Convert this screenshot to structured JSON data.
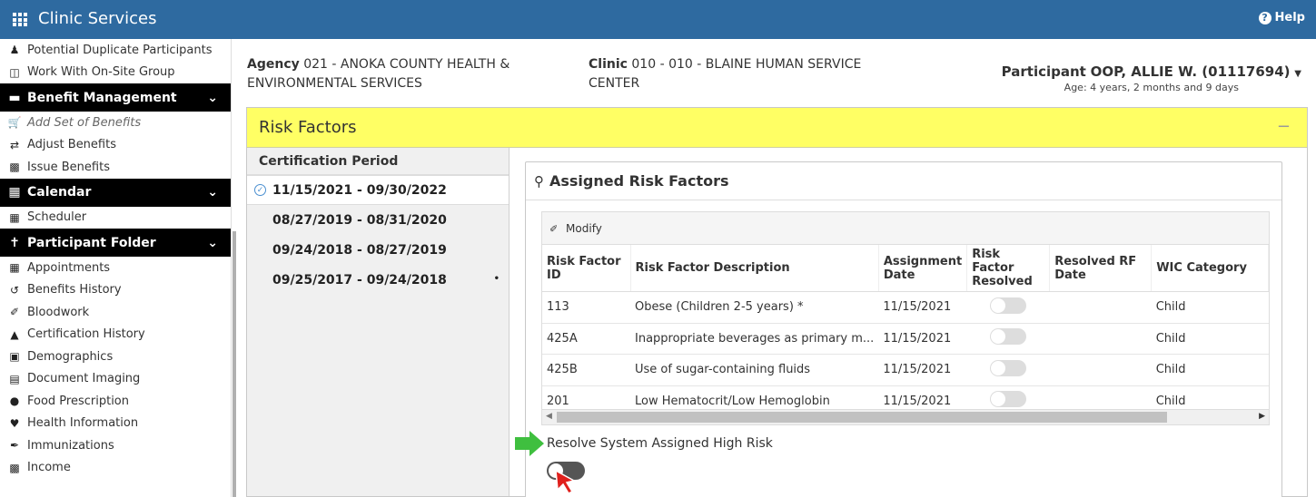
{
  "app": {
    "title": "Clinic Services",
    "help_label": "Help"
  },
  "sidebar": {
    "top_items": [
      {
        "label": "Potential Duplicate Participants",
        "icon": "user-edit-icon"
      },
      {
        "label": "Work With On-Site Group",
        "icon": "group-icon"
      }
    ],
    "benefit": {
      "header": "Benefit Management",
      "items": [
        {
          "label": "Add Set of Benefits",
          "icon": "cart-icon"
        },
        {
          "label": "Adjust Benefits",
          "icon": "exchange-icon"
        },
        {
          "label": "Issue Benefits",
          "icon": "card-icon"
        }
      ]
    },
    "calendar": {
      "header": "Calendar",
      "items": [
        {
          "label": "Scheduler",
          "icon": "calendar-icon"
        }
      ]
    },
    "participant": {
      "header": "Participant Folder",
      "items": [
        {
          "label": "Appointments",
          "icon": "calendar-grid-icon"
        },
        {
          "label": "Benefits History",
          "icon": "history-icon"
        },
        {
          "label": "Bloodwork",
          "icon": "eyedropper-icon"
        },
        {
          "label": "Certification History",
          "icon": "graduation-icon"
        },
        {
          "label": "Demographics",
          "icon": "id-badge-icon"
        },
        {
          "label": "Document Imaging",
          "icon": "document-icon"
        },
        {
          "label": "Food Prescription",
          "icon": "apple-icon"
        },
        {
          "label": "Health Information",
          "icon": "heartbeat-icon"
        },
        {
          "label": "Immunizations",
          "icon": "syringe-icon"
        },
        {
          "label": "Income",
          "icon": "money-icon"
        }
      ]
    }
  },
  "header": {
    "agency_label": "Agency",
    "agency_value": "021 - ANOKA COUNTY HEALTH & ENVIRONMENTAL SERVICES",
    "clinic_label": "Clinic",
    "clinic_value": "010 - 010 - BLAINE HUMAN SERVICE CENTER",
    "participant_label": "Participant",
    "participant_value": "OOP, ALLIE W. (01117694)",
    "age": "Age: 4 years, 2 months and 9 days"
  },
  "risk_factors": {
    "panel_title": "Risk Factors",
    "collapse_symbol": "−",
    "cert_header": "Certification Period",
    "periods": [
      "11/15/2021 - 09/30/2022",
      "08/27/2019 - 08/31/2020",
      "09/24/2018 - 08/27/2019",
      "09/25/2017 - 09/24/2018"
    ],
    "assigned_title": "Assigned Risk Factors",
    "modify_label": "Modify",
    "columns": {
      "id": "Risk Factor ID",
      "desc": "Risk Factor Description",
      "date": "Assignment Date",
      "resolved": "Risk Factor Resolved",
      "resolved_date": "Resolved RF Date",
      "wic": "WIC Category"
    },
    "rows": [
      {
        "id": "113",
        "desc": "Obese (Children 2-5 years) *",
        "date": "11/15/2021",
        "resolved_date": "",
        "wic": "Child"
      },
      {
        "id": "425A",
        "desc": "Inappropriate beverages as primary m...",
        "date": "11/15/2021",
        "resolved_date": "",
        "wic": "Child"
      },
      {
        "id": "425B",
        "desc": "Use of sugar-containing fluids",
        "date": "11/15/2021",
        "resolved_date": "",
        "wic": "Child"
      },
      {
        "id": "201",
        "desc": "Low Hematocrit/Low Hemoglobin",
        "date": "11/15/2021",
        "resolved_date": "",
        "wic": "Child"
      }
    ],
    "resolve_label": "Resolve System Assigned High Risk"
  },
  "colors": {
    "topbar": "#2e6aa0",
    "panel_header": "#ffff64",
    "sidebar_header": "#000000",
    "accent_green": "#3fbf3f",
    "cursor_red": "#e0201c"
  }
}
